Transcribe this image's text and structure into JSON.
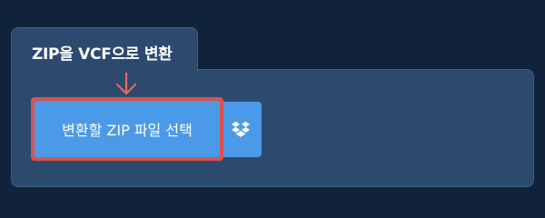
{
  "panel": {
    "title": "ZIP을 VCF으로 변환"
  },
  "upload": {
    "select_label": "변환할 ZIP 파일 선택",
    "dropbox_icon": "dropbox-icon"
  },
  "colors": {
    "background": "#11233a",
    "panel": "#2c4a6e",
    "button": "#4b9ae8",
    "highlight": "#d9534f"
  }
}
